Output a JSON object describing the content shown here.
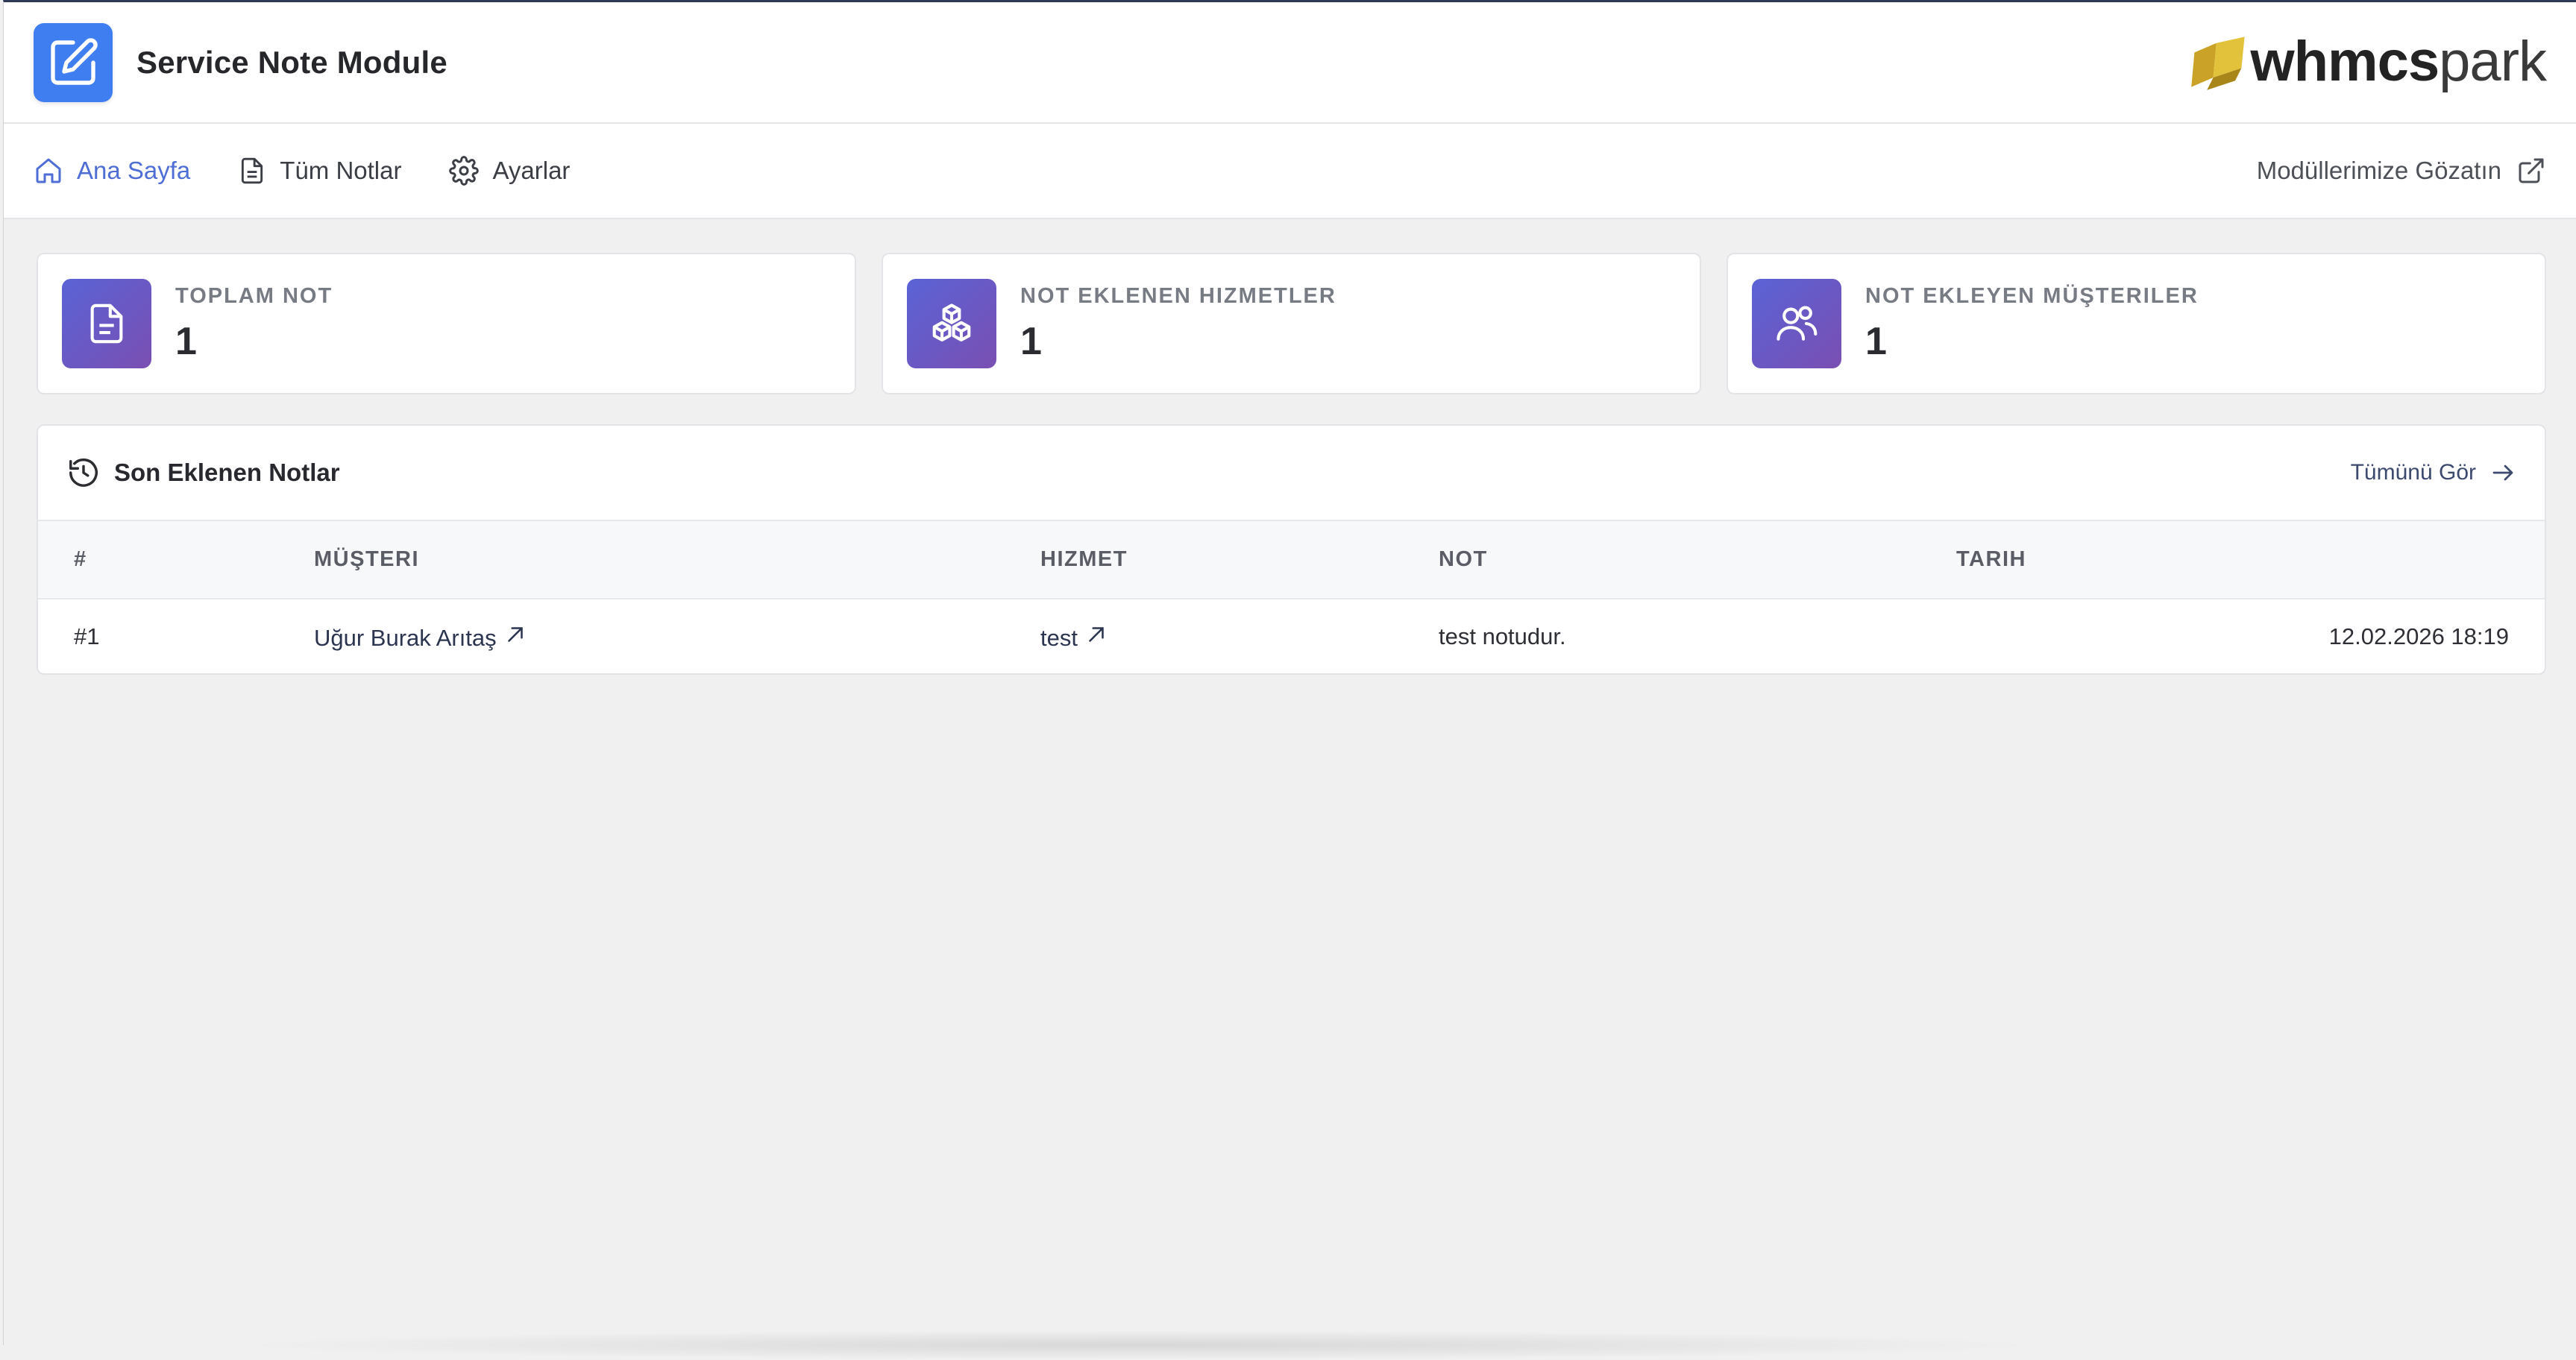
{
  "app": {
    "title": "Service Note Module",
    "brand_bold": "whmcs",
    "brand_light": "park"
  },
  "nav": {
    "items": [
      {
        "label": "Ana Sayfa",
        "icon": "home-icon",
        "active": true
      },
      {
        "label": "Tüm Notlar",
        "icon": "document-icon",
        "active": false
      },
      {
        "label": "Ayarlar",
        "icon": "gear-icon",
        "active": false
      }
    ],
    "external_link": "Modüllerimize Gözatın"
  },
  "stats": [
    {
      "label": "TOPLAM NOT",
      "value": "1",
      "icon": "file-text-icon"
    },
    {
      "label": "NOT EKLENEN HIZMETLER",
      "value": "1",
      "icon": "boxes-icon"
    },
    {
      "label": "NOT EKLEYEN MÜŞTERILER",
      "value": "1",
      "icon": "users-icon"
    }
  ],
  "recent": {
    "title": "Son Eklenen Notlar",
    "view_all": "Tümünü Gör",
    "columns": [
      "#",
      "MÜŞTERI",
      "HIZMET",
      "NOT",
      "TARIH"
    ],
    "rows": [
      {
        "id": "#1",
        "customer": "Uğur Burak Arıtaş",
        "service": "test",
        "note": "test notudur.",
        "date": "12.02.2026 18:19"
      }
    ]
  },
  "colors": {
    "accent": "#4e6ed6",
    "logo_bg": "#3f7ef0",
    "stat_gradient_start": "#5a63d6",
    "stat_gradient_end": "#7a4fb2"
  }
}
